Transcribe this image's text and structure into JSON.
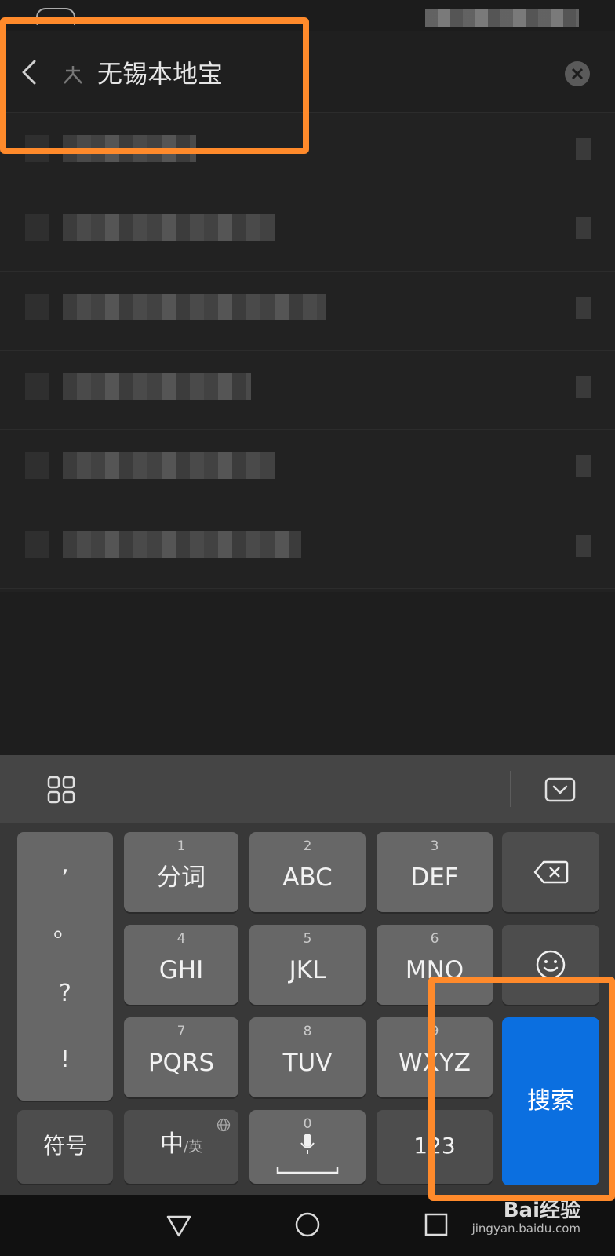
{
  "search": {
    "query": "无锡本地宝"
  },
  "results": [
    {
      "id": 1
    },
    {
      "id": 2
    },
    {
      "id": 3
    },
    {
      "id": 4
    },
    {
      "id": 5
    },
    {
      "id": 6
    }
  ],
  "keyboard": {
    "punctuation": [
      ",",
      "。",
      "?",
      "!"
    ],
    "keys": [
      {
        "num": "1",
        "label": "分词"
      },
      {
        "num": "2",
        "label": "ABC"
      },
      {
        "num": "3",
        "label": "DEF"
      },
      {
        "num": "4",
        "label": "GHI"
      },
      {
        "num": "5",
        "label": "JKL"
      },
      {
        "num": "6",
        "label": "MNO"
      },
      {
        "num": "7",
        "label": "PQRS"
      },
      {
        "num": "8",
        "label": "TUV"
      },
      {
        "num": "9",
        "label": "WXYZ"
      }
    ],
    "symbols_label": "符号",
    "lang_main": "中",
    "lang_sub": "/英",
    "space_num": "0",
    "numbers_label": "123",
    "search_label": "搜索"
  },
  "watermark": {
    "main": "Bai经验",
    "sub": "jingyan.baidu.com"
  },
  "colors": {
    "highlight": "#ff8a2b",
    "search_key": "#0b6fe0"
  }
}
